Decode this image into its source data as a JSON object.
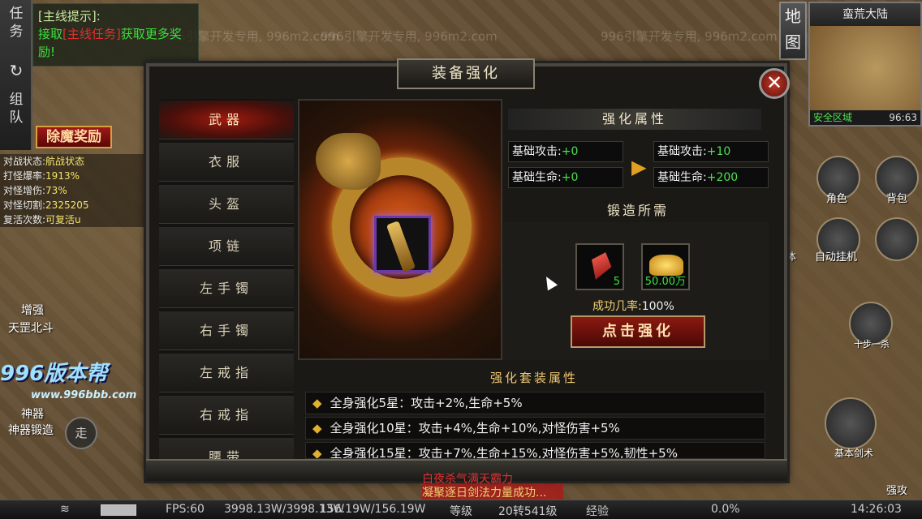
{
  "watermarks": [
    "996引擎开发专用, 996m2.com",
    "996引擎开发专用, 996m2.com",
    "996引擎开发专用, 996m2.com"
  ],
  "left_hud": {
    "tabs": [
      "任务",
      "组队"
    ],
    "quest_title": "[主线提示]:",
    "quest_line1_a": "接取",
    "quest_line1_b": "[主线任务]",
    "quest_line1_c": "获取更多奖",
    "quest_line2": "励!",
    "reward_btn": "除魔奖励",
    "stats": [
      {
        "label": "对战状态:",
        "value": "航战状态"
      },
      {
        "label": "打怪爆率:",
        "value": "1913%"
      },
      {
        "label": "对怪增伤:",
        "value": "73%"
      },
      {
        "label": "对怪切割:",
        "value": "2325205"
      },
      {
        "label": "复活次数:",
        "value": "可复活u"
      }
    ],
    "player_labels": [
      "增强",
      "天罡北斗",
      "神器",
      "神器锻造"
    ],
    "logo": "996版本帮",
    "logo_url": "www.996bbb.com",
    "walk_btn": "走"
  },
  "minimap": {
    "map_btn": "地图",
    "title": "蛮荒大陆",
    "safe_zone": "安全区域",
    "coords": "96:63"
  },
  "right_hud": {
    "buttons": [
      "角色",
      "背包",
      "体",
      "自动挂机",
      "十步一杀",
      "基本剑术",
      "强攻"
    ]
  },
  "dialog": {
    "title": "装备强化",
    "close_icon": "✕",
    "tabs": [
      "武器",
      "衣服",
      "头盔",
      "项链",
      "左手镯",
      "右手镯",
      "左戒指",
      "右戒指",
      "腰带"
    ],
    "active_tab": 0,
    "attr_header": "强化属性",
    "current": [
      {
        "key": "基础攻击:",
        "val": "+0"
      },
      {
        "key": "基础生命:",
        "val": "+0"
      }
    ],
    "next": [
      {
        "key": "基础攻击:",
        "val": "+10"
      },
      {
        "key": "基础生命:",
        "val": "+200"
      }
    ],
    "arrow": "▶",
    "forge_header": "锻造所需",
    "materials": [
      {
        "icon": "red-crystal-icon",
        "count": "5"
      },
      {
        "icon": "gold-ingot-icon",
        "count": "50.00万"
      }
    ],
    "rate_label": "成功几率:",
    "rate_value": "100%",
    "action_btn": "点击强化",
    "suit_header": "强化套装属性",
    "suit_rows": [
      "全身强化5星：攻击+2%,生命+5%",
      "全身强化10星：攻击+4%,生命+10%,对怪伤害+5%",
      "全身强化15星：攻击+7%,生命+15%,对怪伤害+5%,韧性+5%"
    ]
  },
  "chat": {
    "line1": "白夜杀气满天霸力",
    "line2": "凝聚逐日剑法力量成功..."
  },
  "bottom_bar": {
    "fps": "FPS:60",
    "hp": "3998.13W/3998.13W",
    "mp": "156.19W/156.19W",
    "level_label": "等级",
    "level": "20转541级",
    "exp_label": "经验",
    "exp": "0.0%",
    "time": "14:26:03"
  }
}
